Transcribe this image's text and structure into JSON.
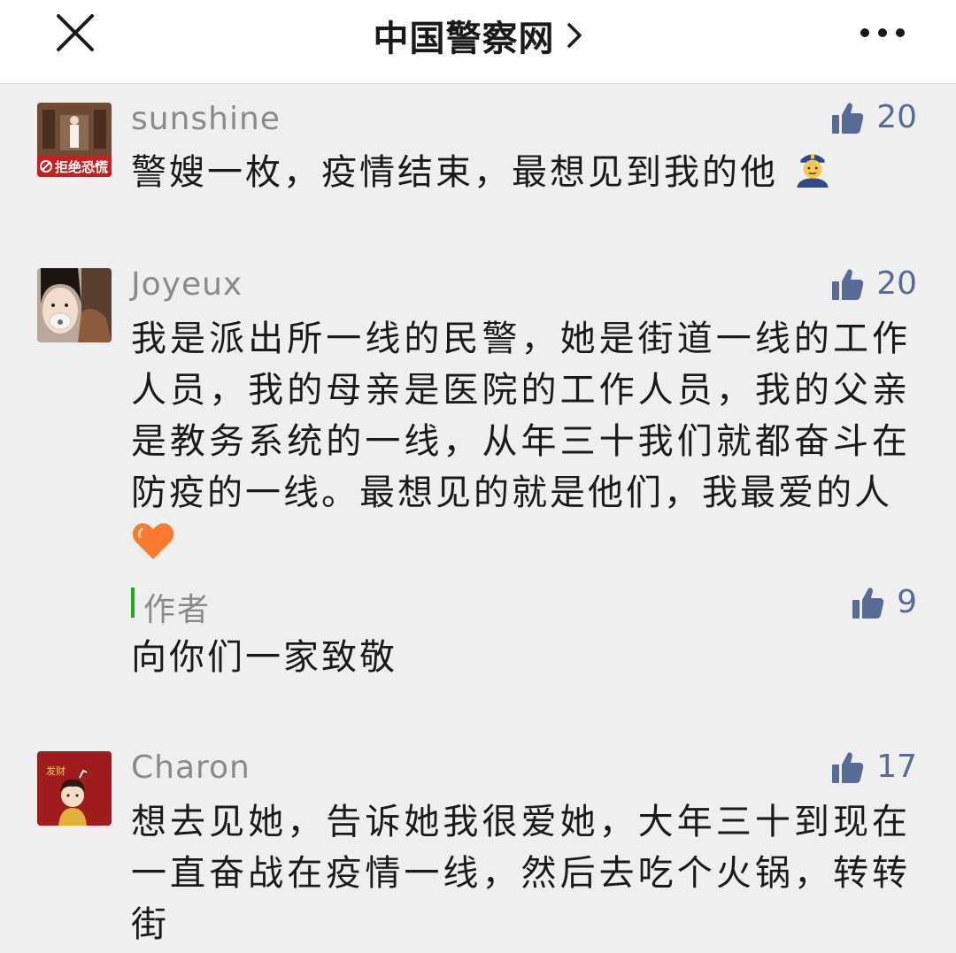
{
  "header": {
    "title": "中国警察网",
    "close_icon": "close-icon",
    "chevron_icon": "chevron-right-icon",
    "more_icon": "more-icon"
  },
  "colors": {
    "like_count": "#576b95",
    "author_accent": "#1aad19",
    "nickname": "#8a8a8a",
    "text": "#1a1a1a",
    "background": "#efefef"
  },
  "comments": [
    {
      "nickname": "sunshine",
      "likes": "20",
      "text": "警嫂一枚，疫情结束，最想见到我的他",
      "emoji": "police-officer-emoji",
      "avatar_badge": "拒绝恐慌"
    },
    {
      "nickname": "Joyeux",
      "likes": "20",
      "text": "我是派出所一线的民警，她是街道一线的工作人员，我的母亲是医院的工作人员，我的父亲是教务系统的一线，从年三十我们就都奋斗在防疫的一线。最想见的就是他们，我最爱的人",
      "emoji": "orange-heart-emoji",
      "reply": {
        "label": "作者",
        "likes": "9",
        "text": "向你们一家致敬"
      }
    },
    {
      "nickname": "Charon",
      "likes": "17",
      "text": "想去见她，告诉她我很爱她，大年三十到现在一直奋战在疫情一线，然后去吃个火锅，转转街",
      "avatar_badge": "发财"
    }
  ]
}
